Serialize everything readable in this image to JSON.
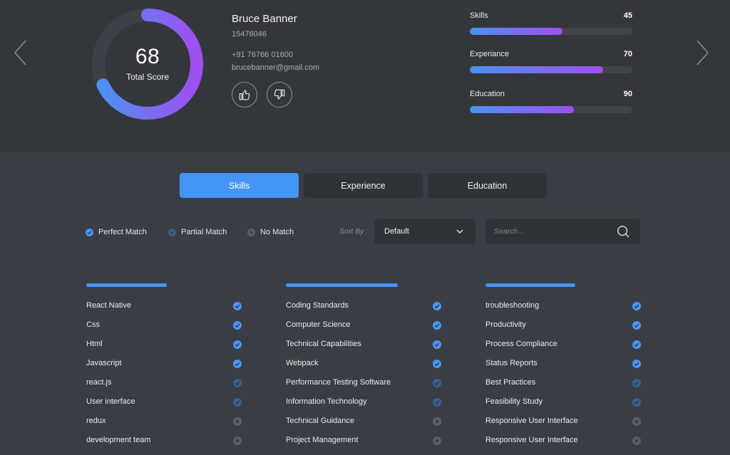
{
  "profile": {
    "name": "Bruce Banner",
    "id": "15476046",
    "phone": "+91 76766 01600",
    "email": "brucebanner@gmail.com"
  },
  "total_score": {
    "value": "68",
    "label": "Total Score",
    "fraction": 0.68
  },
  "icons": {
    "prev": "chevron-left-icon",
    "next": "chevron-right-icon",
    "like": "thumbs-up-icon",
    "dislike": "thumbs-down-icon",
    "search": "search-icon",
    "dropdown": "chevron-down-icon",
    "status": "check-icon"
  },
  "score_bars": [
    {
      "label": "Skills",
      "value": "45",
      "fill": 0.57
    },
    {
      "label": "Experiance",
      "value": "70",
      "fill": 0.82
    },
    {
      "label": "Education",
      "value": "90",
      "fill": 0.64
    }
  ],
  "tabs": [
    {
      "label": "Skills",
      "active": true
    },
    {
      "label": "Experience",
      "active": false
    },
    {
      "label": "Education",
      "active": false
    }
  ],
  "legend": [
    {
      "label": "Perfect Match",
      "status": "perfect"
    },
    {
      "label": "Partial Match",
      "status": "partial"
    },
    {
      "label": "No Match",
      "status": "none"
    }
  ],
  "sort": {
    "label": "Sort By :",
    "value": "Default"
  },
  "search": {
    "placeholder": "Search..."
  },
  "colors": {
    "accent": "#4495f4",
    "gradient_start": "#4a92f2",
    "gradient_end": "#a04ff0",
    "perfect": "#4a97f5",
    "partial": "#39618d",
    "none": "#5c6066"
  },
  "skill_columns": [
    {
      "bar_fill": 0.52,
      "items": [
        {
          "name": "React Native",
          "status": "perfect"
        },
        {
          "name": "Css",
          "status": "perfect"
        },
        {
          "name": "Html",
          "status": "perfect"
        },
        {
          "name": "Javascript",
          "status": "perfect"
        },
        {
          "name": "react.js",
          "status": "partial"
        },
        {
          "name": "User interface",
          "status": "partial"
        },
        {
          "name": "redux",
          "status": "none"
        },
        {
          "name": "development team",
          "status": "none"
        }
      ]
    },
    {
      "bar_fill": 0.72,
      "items": [
        {
          "name": "Coding Standards",
          "status": "perfect"
        },
        {
          "name": "Computer Science",
          "status": "perfect"
        },
        {
          "name": "Technical Capabilities",
          "status": "perfect"
        },
        {
          "name": "Webpack",
          "status": "perfect"
        },
        {
          "name": "Performance Testing Software",
          "status": "partial"
        },
        {
          "name": "Information Technology",
          "status": "partial"
        },
        {
          "name": "Technical Guidance",
          "status": "none"
        },
        {
          "name": "Project Management",
          "status": "none"
        }
      ]
    },
    {
      "bar_fill": 0.58,
      "items": [
        {
          "name": "troubleshooting",
          "status": "perfect"
        },
        {
          "name": "Productivity",
          "status": "perfect"
        },
        {
          "name": "Process Compliance",
          "status": "perfect"
        },
        {
          "name": "Status Reports",
          "status": "perfect"
        },
        {
          "name": "Best Practices",
          "status": "partial"
        },
        {
          "name": "Feasibility Study",
          "status": "partial"
        },
        {
          "name": "Responsive User Interface",
          "status": "none"
        },
        {
          "name": "Responsive User Interface",
          "status": "none"
        }
      ]
    }
  ]
}
